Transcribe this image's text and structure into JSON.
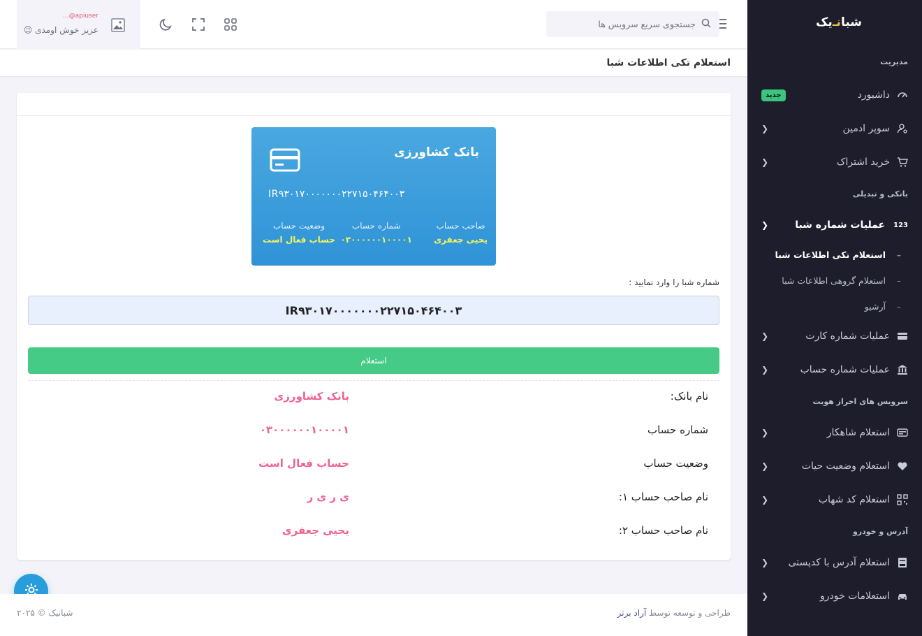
{
  "brand": {
    "name_a": "شبا",
    "name_dot": "نـ",
    "name_b": "یک"
  },
  "sidebar": {
    "sections": [
      "مدیریت",
      "بانکی و تبدیلی",
      "سرویس های احراز هویت",
      "آدرس و خودرو"
    ],
    "items": [
      {
        "label": "داشبورد",
        "icon": "dashboard-icon",
        "badge": "جدید"
      },
      {
        "label": "سوپر ادمین",
        "icon": "user-settings-icon"
      },
      {
        "label": "خرید اشتراک",
        "icon": "cart-icon"
      },
      {
        "label": "عملیات شماره شبا",
        "icon": "123",
        "active": true
      },
      {
        "label": "عملیات شماره کارت",
        "icon": "card-icon"
      },
      {
        "label": "عملیات شماره حساب",
        "icon": "bank-icon"
      },
      {
        "label": "استعلام شاهکار",
        "icon": "id-card-icon"
      },
      {
        "label": "استعلام وضعیت حیات",
        "icon": "heart-icon"
      },
      {
        "label": "استعلام کد شهاب",
        "icon": "qr-icon"
      },
      {
        "label": "استعلام آدرس با کدپستی",
        "icon": "postal-icon"
      },
      {
        "label": "استعلامات خودرو",
        "icon": "car-icon"
      }
    ],
    "sub_items": [
      {
        "label": "استعلام تکی اطلاعات شبا",
        "active": true
      },
      {
        "label": "استعلام گروهی اطلاعات شبا"
      },
      {
        "label": "آرشیو"
      }
    ]
  },
  "topbar": {
    "search_placeholder": "جستجوی سریع سرویس ها",
    "user_name": "apiuser@...",
    "user_welcome": "عزیز خوش اومدی 😉"
  },
  "page": {
    "title": "استعلام تکی اطلاعات شبا"
  },
  "bank_card": {
    "bank_name": "بانک کشاورزی",
    "iban": "IR۹۳۰۱۷۰۰۰۰۰۰۰۲۲۷۱۵۰۴۶۴۰۰۳",
    "owner_label": "صاحب حساب",
    "owner_value": "یحیی جعفری",
    "account_label": "شماره حساب",
    "account_value": "۰۳۰۰۰۰۰۰۱۰۰۰۰۱",
    "status_label": "وضعیت حساب",
    "status_value": "حساب فعال است"
  },
  "form": {
    "input_label": "شماره شبا را وارد نمایید :",
    "iban_value": "IR۹۳۰۱۷۰۰۰۰۰۰۰۲۲۷۱۵۰۴۶۴۰۰۳",
    "submit_label": "استعلام"
  },
  "results": [
    {
      "key": "نام بانک:",
      "value": "بانک کشاورزی"
    },
    {
      "key": "شماره حساب",
      "value": "۰۳۰۰۰۰۰۰۱۰۰۰۰۱"
    },
    {
      "key": "وضعیت حساب",
      "value": "حساب فعال است"
    },
    {
      "key": "نام صاحب حساب ۱:",
      "value": "ی ر ی ر"
    },
    {
      "key": "نام صاحب حساب ۲:",
      "value": "یحیی جعفری"
    }
  ],
  "footer": {
    "copyright": "شبانیک © ۲۰۲۵",
    "credit_prefix": "طراحی و توسعه توسط",
    "credit_link": "آراد برتر"
  },
  "colors": {
    "sidebar_bg": "#1d1d2b",
    "accent_green": "#45cb85",
    "result_pink": "#f06292",
    "card_blue": "#3a9edc"
  }
}
